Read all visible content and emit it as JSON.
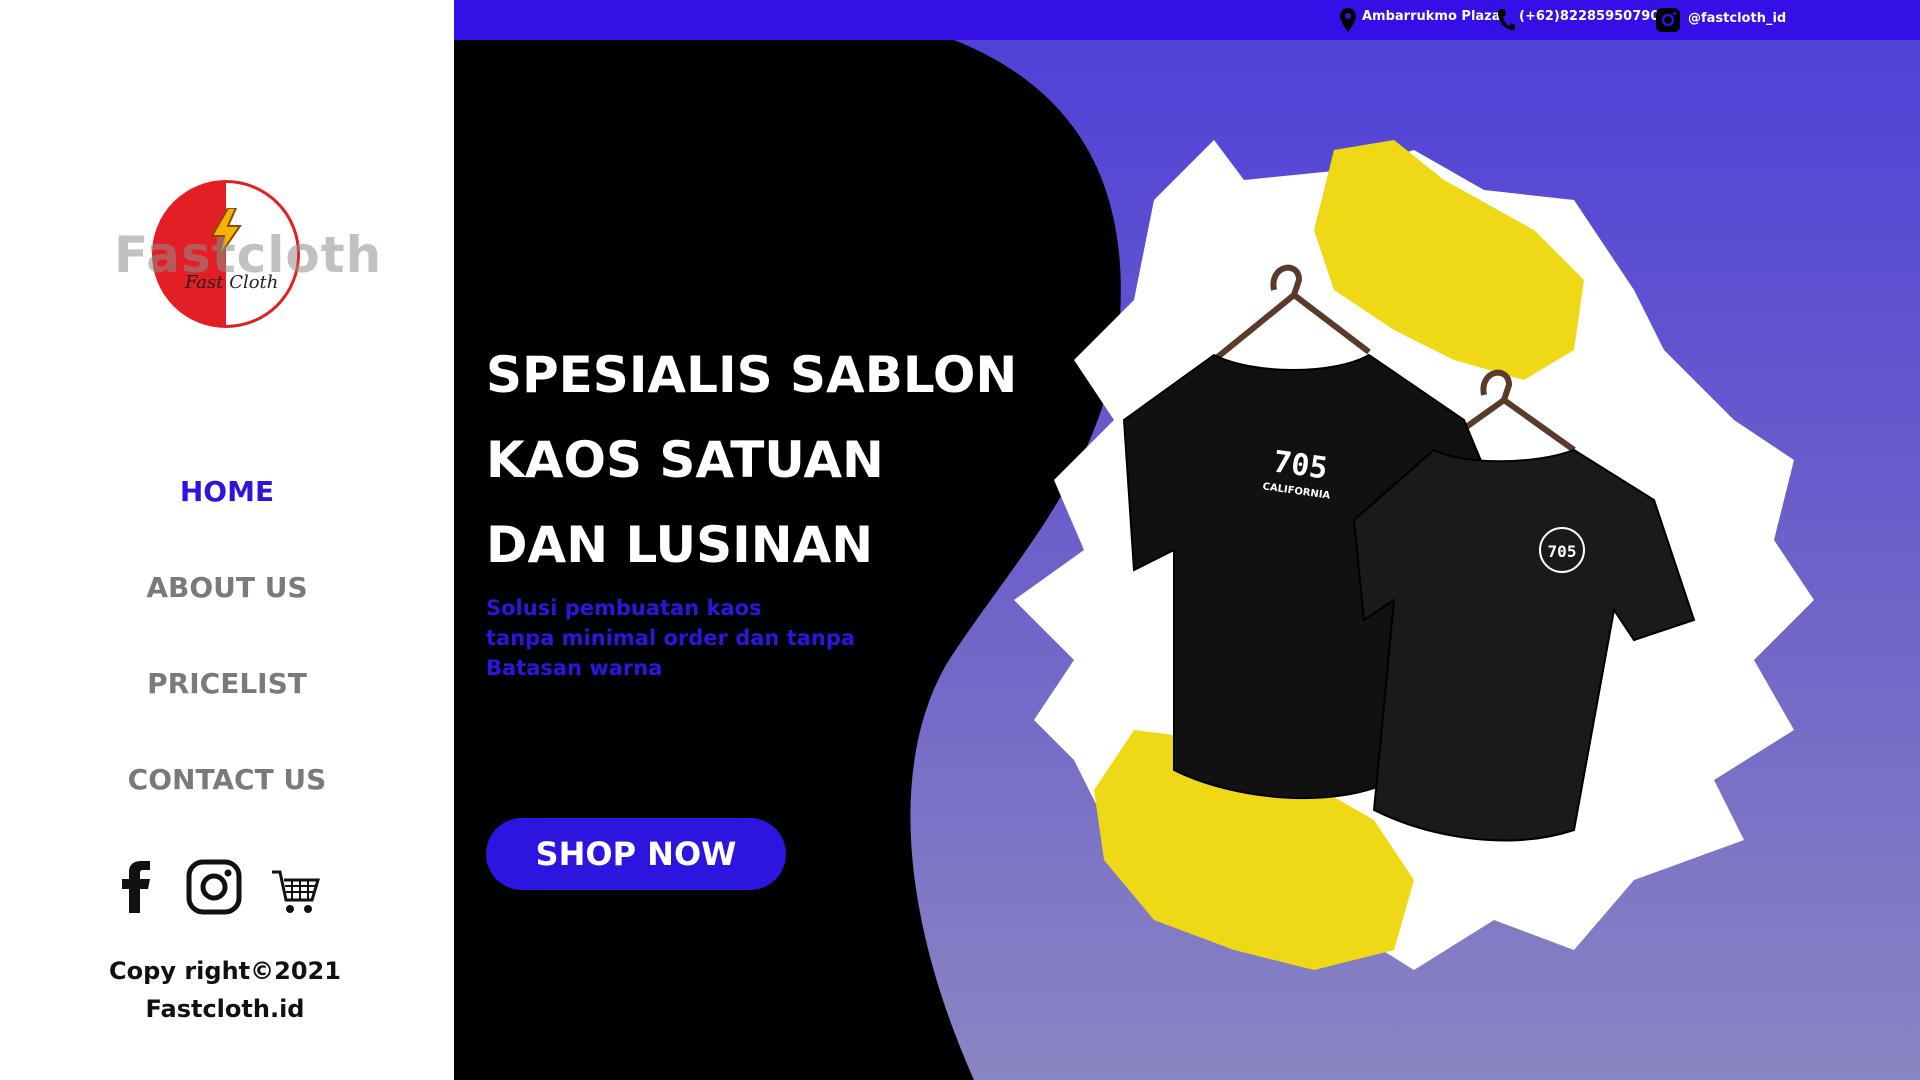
{
  "brand": {
    "logo_word": "Fastcloth",
    "logo_script": "Fast Cloth"
  },
  "nav": {
    "items": [
      {
        "label": "HOME",
        "active": true
      },
      {
        "label": "ABOUT US",
        "active": false
      },
      {
        "label": "PRICELIST",
        "active": false
      },
      {
        "label": "CONTACT US",
        "active": false
      }
    ]
  },
  "social": {
    "icons": [
      "facebook-icon",
      "instagram-icon",
      "shopping-cart-icon"
    ]
  },
  "footer": {
    "copyright_line1": "Copy right©2021",
    "copyright_line2": "Fastcloth.id"
  },
  "topbar": {
    "location": "Ambarrukmo Plaza",
    "phone": "(+62)82285950790",
    "instagram": "@fastcloth_id"
  },
  "hero": {
    "headline_line1": "SPESIALIS SABLON",
    "headline_line2": "KAOS SATUAN",
    "headline_line3": "DAN LUSINAN",
    "sub_line1": "Solusi pembuatan kaos",
    "sub_line2": "tanpa minimal order dan tanpa",
    "sub_line3": "Batasan warna",
    "cta_label": "SHOP NOW",
    "shirt1_print_number": "705",
    "shirt1_print_text": "CALIFORNIA",
    "shirt2_print_number": "705"
  },
  "colors": {
    "accent": "#2d15e0",
    "topbar": "#3410e6",
    "logo_red": "#e31e24",
    "yellow": "#efd916"
  }
}
